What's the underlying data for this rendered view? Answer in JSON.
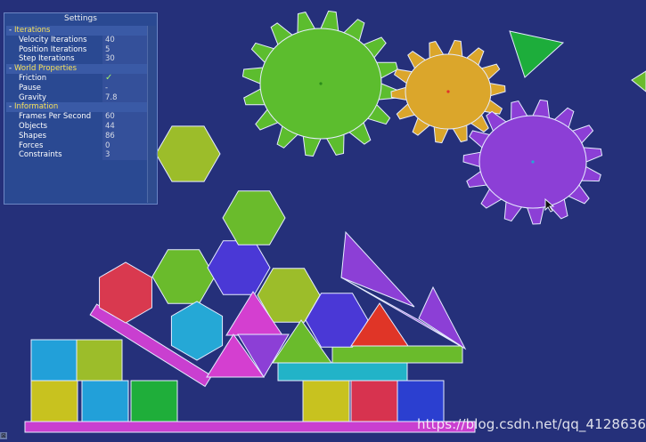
{
  "settings": {
    "title": "Settings",
    "sections": [
      {
        "label": "Iterations",
        "toggle": "-",
        "rows": [
          {
            "label": "Velocity Iterations",
            "value": "40"
          },
          {
            "label": "Position Iterations",
            "value": "5"
          },
          {
            "label": "Step Iterations",
            "value": "30"
          }
        ]
      },
      {
        "label": "World Properties",
        "toggle": "-",
        "rows": [
          {
            "label": "Friction",
            "value": "✓"
          },
          {
            "label": "Pause",
            "value": "-"
          },
          {
            "label": "Gravity",
            "value": "7.8"
          }
        ]
      },
      {
        "label": "Information",
        "toggle": "-",
        "rows": [
          {
            "label": "Frames Per Second",
            "value": "60"
          },
          {
            "label": "Objects",
            "value": "44"
          },
          {
            "label": "Shapes",
            "value": "86"
          },
          {
            "label": "Forces",
            "value": "0"
          },
          {
            "label": "Constraints",
            "value": "3"
          }
        ]
      }
    ]
  },
  "watermark": "https://blog.csdn.net/qq_41286360",
  "colors": {
    "background": "#25307a",
    "gear_green": "#5cbd2e",
    "gear_orange": "#dba62b",
    "gear_purple": "#8c3fd6",
    "hexagon_lime": "#9cbd2a",
    "hexagon_green": "#6abb2c",
    "hexagon_blue": "#4a38d6",
    "hexagon_red": "#d9394f",
    "hexagon_cyan": "#25a8d6",
    "triangle_green": "#1dad3b",
    "triangle_magenta": "#d43fd0",
    "triangle_red": "#e03527",
    "triangle_purple": "#8c3fd6",
    "box_cyan": "#22a0d9",
    "box_olive": "#9cbd2a",
    "box_yellow": "#c8c21f",
    "box_green": "#1fae3a",
    "box_red": "#d7334f",
    "box_blue": "#2b3fd0",
    "plank_magenta": "#c93fd0",
    "plank_lime": "#6abb2c",
    "plank_teal": "#22b3c8",
    "outline": "#e6ecff"
  },
  "icons": {
    "cursor": "mouse-pointer-icon",
    "collapse": "minus-toggle-icon",
    "check": "check-icon"
  }
}
